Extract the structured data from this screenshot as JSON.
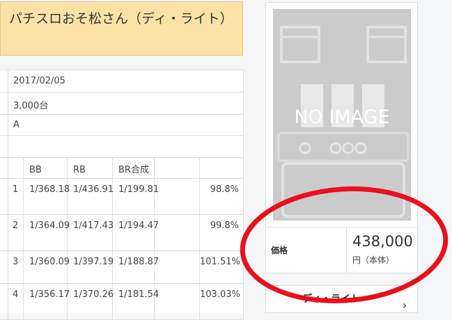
{
  "title": "パチスロおそ松さん（ディ・ライト）",
  "specs": {
    "release_date": "2017/02/05",
    "units": "3,000台",
    "type": "A",
    "blank": ""
  },
  "probability_table": {
    "headers": [
      "",
      "BB",
      "RB",
      "BR合成",
      "",
      ""
    ],
    "rows": [
      {
        "setting": "1",
        "bb": "1/368.18",
        "rb": "1/436.91",
        "br": "1/199.81",
        "extra": "",
        "payout": "98.8%"
      },
      {
        "setting": "2",
        "bb": "1/364.09",
        "rb": "1/417.43",
        "br": "1/194.47",
        "extra": "",
        "payout": "99.8%"
      },
      {
        "setting": "3",
        "bb": "1/360.09",
        "rb": "1/397.19",
        "br": "1/188.87",
        "extra": "",
        "payout": "101.51%"
      },
      {
        "setting": "4",
        "bb": "1/356.17",
        "rb": "1/370.26",
        "br": "1/181.54",
        "extra": "",
        "payout": "103.03%"
      }
    ]
  },
  "product_card": {
    "image_placeholder": "NO IMAGE",
    "price_label": "価格",
    "price_value": "438,000",
    "price_unit": "円（本体）"
  },
  "maker_link": {
    "label": "ディ・ライト",
    "icon": "chevron-right-icon"
  },
  "colors": {
    "title_bg": "#fde2a8",
    "annotation_red": "#e8101c"
  }
}
